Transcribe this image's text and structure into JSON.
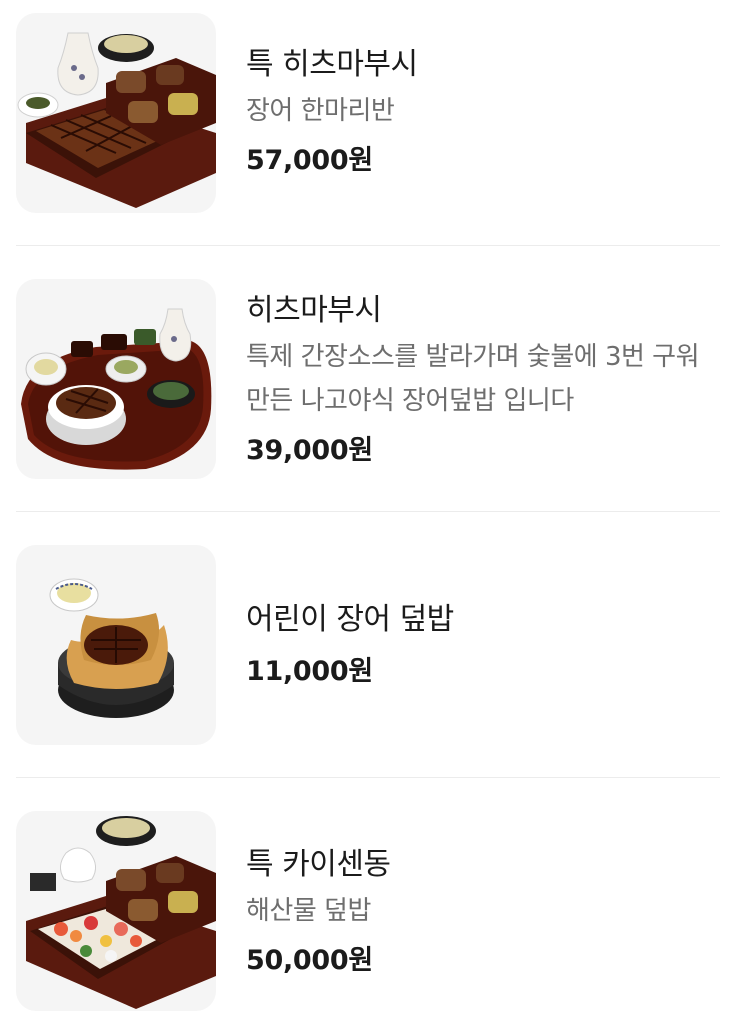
{
  "menu": {
    "items": [
      {
        "name": "특 히츠마부시",
        "description": "장어 한마리반",
        "price": "57,000원",
        "image": "unaju-set-with-sake-image"
      },
      {
        "name": "히츠마부시",
        "description": "특제 간장소스를 발라가며 숯불에 3번 구워 만든 나고야식 장어덮밥 입니다",
        "price": "39,000원",
        "image": "hitsumabushi-tray-image"
      },
      {
        "name": "어린이 장어 덮밥",
        "description": "",
        "price": "11,000원",
        "image": "kids-eel-bowl-image"
      },
      {
        "name": "특 카이센동",
        "description": "해산물 덮밥",
        "price": "50,000원",
        "image": "kaisendon-set-image"
      }
    ]
  },
  "colors": {
    "text": "#1b1b1b",
    "muted": "#6e6e6e",
    "divider": "#ececec",
    "thumb_bg": "#f5f5f5"
  }
}
